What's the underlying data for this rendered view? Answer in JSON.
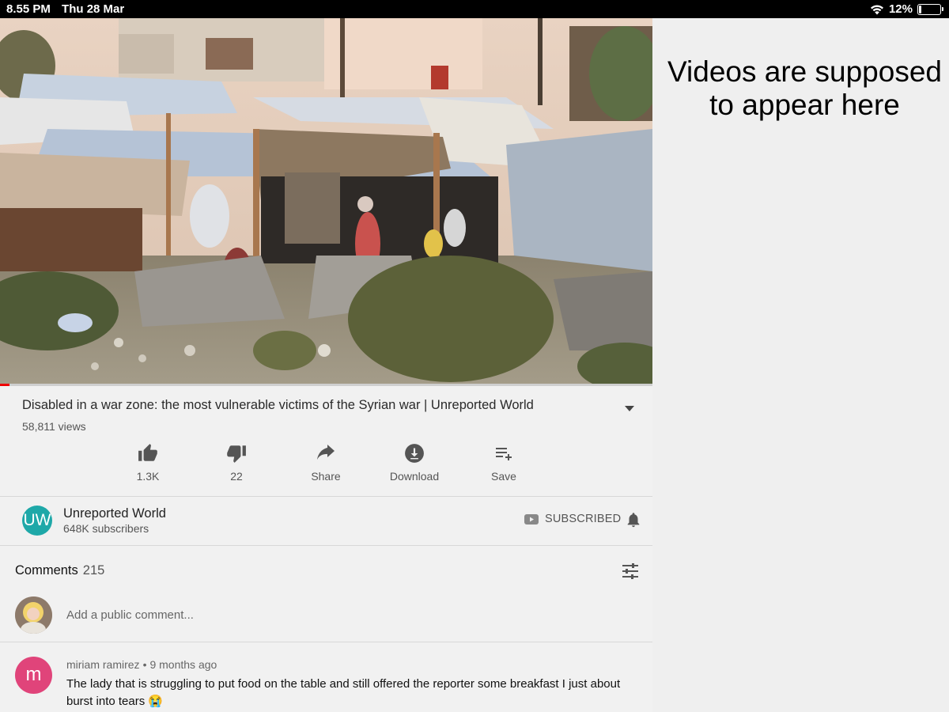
{
  "status_bar": {
    "time": "8.55 PM",
    "date": "Thu 28 Mar",
    "battery": "12%",
    "battery_level": 0.12
  },
  "colors": {
    "accent_red": "#ee0000",
    "channel_avatar": "#1ea8a8",
    "commenter_avatar": "#e0447a"
  },
  "player": {
    "progress_fraction": 0.015
  },
  "right_panel": {
    "message": "Videos are supposed to appear here"
  },
  "video": {
    "title": "Disabled in a war zone: the most vulnerable victims of the Syrian war | Unreported World",
    "views": "58,811 views"
  },
  "actions": {
    "like": {
      "label": "1.3K",
      "icon": "thumbs-up-icon"
    },
    "dislike": {
      "label": "22",
      "icon": "thumbs-down-icon"
    },
    "share": {
      "label": "Share",
      "icon": "share-arrow-icon"
    },
    "download": {
      "label": "Download",
      "icon": "download-icon"
    },
    "save": {
      "label": "Save",
      "icon": "playlist-add-icon"
    }
  },
  "channel": {
    "initials": "UW",
    "name": "Unreported World",
    "subscribers": "648K subscribers",
    "subscribe_label": "SUBSCRIBED"
  },
  "comments": {
    "header": "Comments",
    "count": "215",
    "add_placeholder": "Add a public comment...",
    "items": [
      {
        "avatar_letter": "m",
        "author": "miriam ramirez",
        "time": "9 months ago",
        "text": "The lady that is struggling to put food on the table and still offered the reporter some breakfast I just about burst into tears 😭"
      }
    ]
  }
}
